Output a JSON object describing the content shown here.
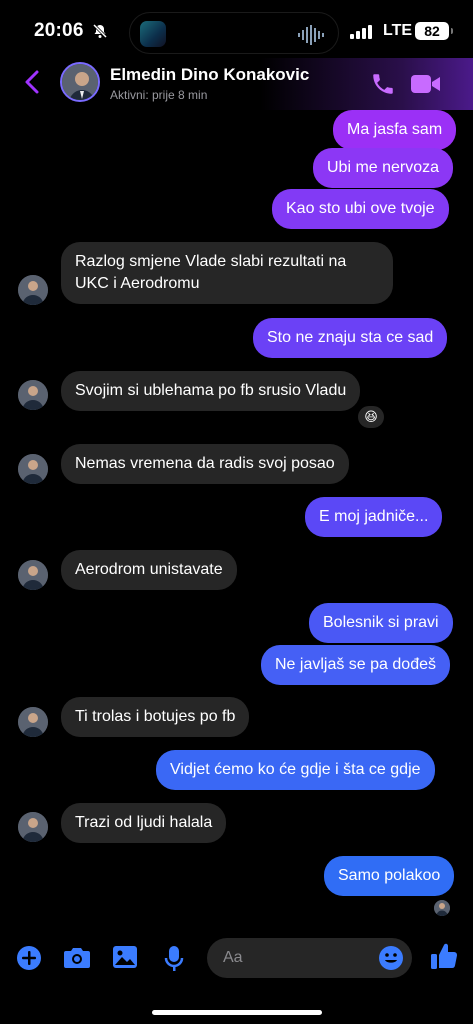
{
  "status_bar": {
    "time": "20:06",
    "network": "LTE",
    "battery": "82"
  },
  "header": {
    "contact_name": "Elmedin Dino Konakovic",
    "status": "Aktivni: prije 8 min"
  },
  "messages": [
    {
      "dir": "out",
      "text": "Ma jasfa sam"
    },
    {
      "dir": "out",
      "text": "Ubi me nervoza"
    },
    {
      "dir": "out",
      "text": "Kao sto ubi ove tvoje"
    },
    {
      "dir": "in",
      "line1": "Razlog smjene Vlade slabi rezultati na",
      "line2": "UKC i Aerodromu"
    },
    {
      "dir": "out",
      "text": "Sto ne znaju sta ce sad"
    },
    {
      "dir": "in",
      "text": "Svojim si ublehama po fb srusio Vladu",
      "reaction": "😆"
    },
    {
      "dir": "in",
      "text": "Nemas vremena da radis svoj posao"
    },
    {
      "dir": "out",
      "text": "E moj jadniče..."
    },
    {
      "dir": "in",
      "text": "Aerodrom unistavate"
    },
    {
      "dir": "out",
      "text": "Bolesnik si pravi"
    },
    {
      "dir": "out",
      "text": "Ne javljaš se pa dođeš"
    },
    {
      "dir": "in",
      "text": "Ti trolas i botujes po fb"
    },
    {
      "dir": "out",
      "text": "Vidjet ćemo ko će gdje i šta ce gdje"
    },
    {
      "dir": "in",
      "text": "Trazi od ljudi halala"
    },
    {
      "dir": "out",
      "text": "Samo polakoo"
    }
  ],
  "composer": {
    "placeholder": "Aa"
  },
  "icons": {
    "add": "plus-circle-icon",
    "camera": "camera-icon",
    "gallery": "image-icon",
    "mic": "microphone-icon",
    "emoji": "emoji-icon",
    "like": "thumbs-up-icon"
  },
  "colors": {
    "accent": "#a033ff",
    "bubble_in": "#262626",
    "bubble_out_top": "#9b2ff5",
    "bubble_out_bottom": "#2f6df5"
  }
}
